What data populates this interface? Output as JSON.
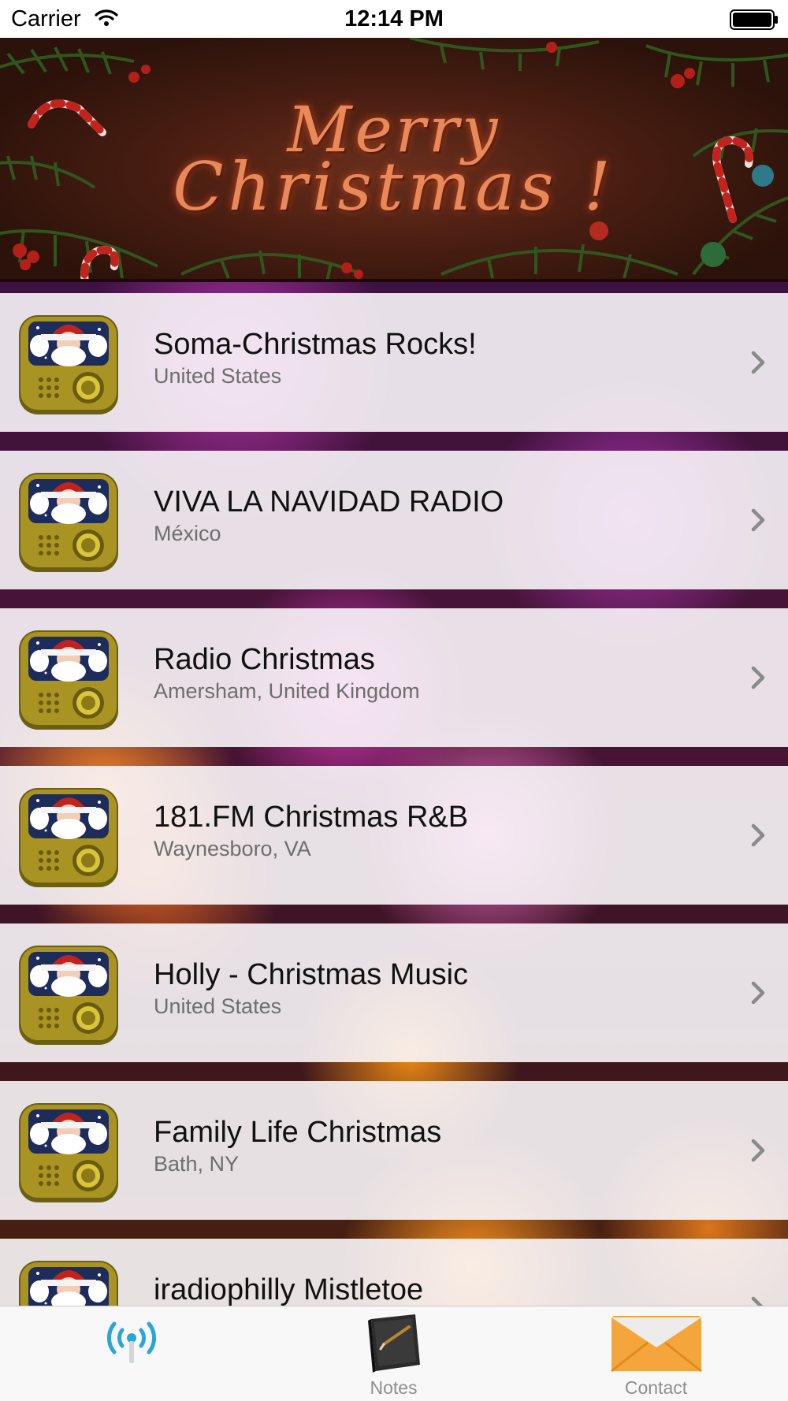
{
  "status_bar": {
    "carrier": "Carrier",
    "time": "12:14 PM",
    "icons": [
      "wifi-icon",
      "battery-icon"
    ]
  },
  "banner": {
    "line1": "Merry",
    "line2": "Christmas !"
  },
  "stations": [
    {
      "title": "Soma-Christmas Rocks!",
      "subtitle": "United States",
      "icon": "santa-radio-icon"
    },
    {
      "title": "VIVA LA NAVIDAD RADIO",
      "subtitle": "México",
      "icon": "santa-radio-icon"
    },
    {
      "title": "Radio Christmas",
      "subtitle": "Amersham, United Kingdom",
      "icon": "santa-radio-icon"
    },
    {
      "title": "181.FM Christmas R&B",
      "subtitle": "Waynesboro, VA",
      "icon": "santa-radio-icon"
    },
    {
      "title": "Holly - Christmas Music",
      "subtitle": "United States",
      "icon": "santa-radio-icon"
    },
    {
      "title": "Family Life Christmas",
      "subtitle": "Bath, NY",
      "icon": "santa-radio-icon"
    },
    {
      "title": "iradiophilly Mistletoe",
      "subtitle": "",
      "icon": "santa-radio-icon"
    }
  ],
  "tabs": [
    {
      "label": "",
      "icon": "radio-antenna-icon",
      "selected": true
    },
    {
      "label": "Notes",
      "icon": "notebook-icon",
      "selected": false
    },
    {
      "label": "Contact",
      "icon": "envelope-icon",
      "selected": false
    }
  ],
  "colors": {
    "tab_selected": "#2aa6d4",
    "row_background": "#f7f2f7",
    "banner_text": "#e8895b"
  }
}
